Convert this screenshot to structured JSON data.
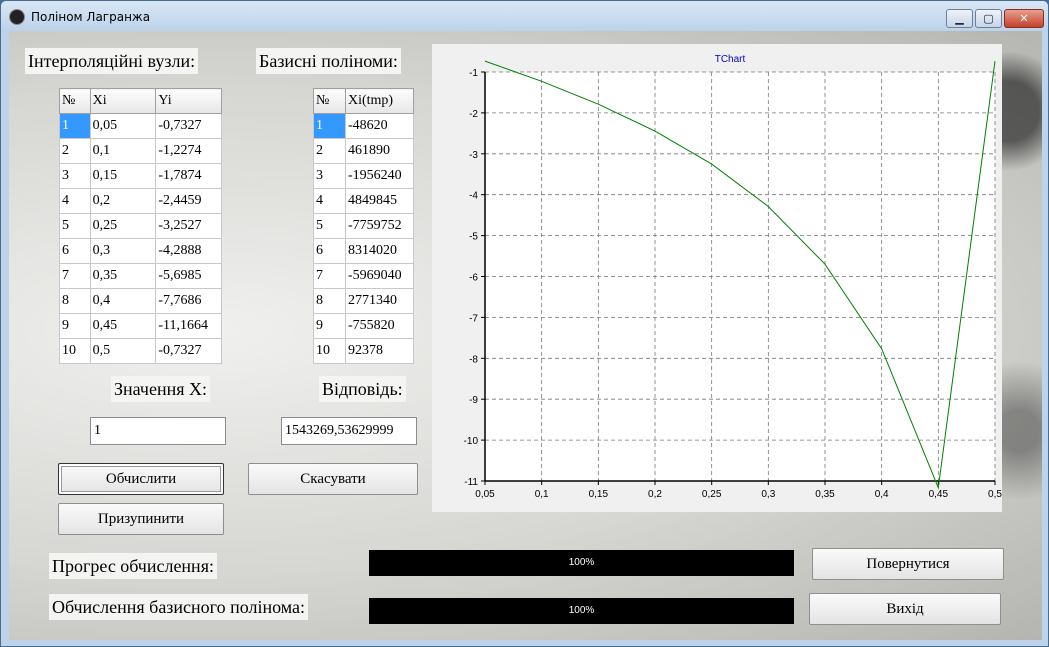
{
  "window": {
    "title": "Поліном Лагранжа",
    "controls": {
      "minimize": "▁",
      "maximize": "▢",
      "close": "✕"
    }
  },
  "labels": {
    "nodes": "Інтерполяційні вузли:",
    "basis": "Базисні поліноми:",
    "x_value": "Значення X:",
    "answer": "Відповідь:",
    "progress": "Прогрес обчислення:",
    "basis_progress": "Обчислення базисного полінома:"
  },
  "nodes_table": {
    "headers": [
      "№",
      "Xi",
      "Yi"
    ],
    "rows": [
      [
        "1",
        "0,05",
        "-0,7327"
      ],
      [
        "2",
        "0,1",
        "-1,2274"
      ],
      [
        "3",
        "0,15",
        "-1,7874"
      ],
      [
        "4",
        "0,2",
        "-2,4459"
      ],
      [
        "5",
        "0,25",
        "-3,2527"
      ],
      [
        "6",
        "0,3",
        "-4,2888"
      ],
      [
        "7",
        "0,35",
        "-5,6985"
      ],
      [
        "8",
        "0,4",
        "-7,7686"
      ],
      [
        "9",
        "0,45",
        "-11,1664"
      ],
      [
        "10",
        "0,5",
        "-0,7327"
      ]
    ]
  },
  "basis_table": {
    "headers": [
      "№",
      "Xi(tmp)"
    ],
    "rows": [
      [
        "1",
        "-48620"
      ],
      [
        "2",
        "461890"
      ],
      [
        "3",
        "-1956240"
      ],
      [
        "4",
        "4849845"
      ],
      [
        "5",
        "-7759752"
      ],
      [
        "6",
        "8314020"
      ],
      [
        "7",
        "-5969040"
      ],
      [
        "8",
        "2771340"
      ],
      [
        "9",
        "-755820"
      ],
      [
        "10",
        "92378"
      ]
    ]
  },
  "inputs": {
    "x_value": "1",
    "answer": "1543269,53629999"
  },
  "buttons": {
    "calculate": "Обчислити",
    "cancel": "Скасувати",
    "pause": "Призупинити",
    "return": "Повернутися",
    "exit": "Вихід"
  },
  "progress": {
    "calc_percent": 100,
    "calc_label": "100%",
    "basis_percent": 100,
    "basis_label": "100%"
  },
  "colors": {
    "series": "#008000",
    "chart_title": "#0000cc",
    "selection": "#3399ff"
  },
  "chart_data": {
    "type": "line",
    "title": "TChart",
    "x": [
      0.05,
      0.1,
      0.15,
      0.2,
      0.25,
      0.3,
      0.35,
      0.4,
      0.45,
      0.5
    ],
    "series": [
      {
        "values": [
          -0.7327,
          -1.2274,
          -1.7874,
          -2.4459,
          -3.2527,
          -4.2888,
          -5.6985,
          -7.7686,
          -11.1664,
          -0.7327
        ]
      }
    ],
    "xlim": [
      0.05,
      0.5
    ],
    "ylim": [
      -11,
      -1
    ],
    "xticks": [
      "0,05",
      "0,1",
      "0,15",
      "0,2",
      "0,25",
      "0,3",
      "0,35",
      "0,4",
      "0,45",
      "0,5"
    ],
    "yticks": [
      "-1",
      "-2",
      "-3",
      "-4",
      "-5",
      "-6",
      "-7",
      "-8",
      "-9",
      "-10",
      "-11"
    ],
    "grid": true
  }
}
